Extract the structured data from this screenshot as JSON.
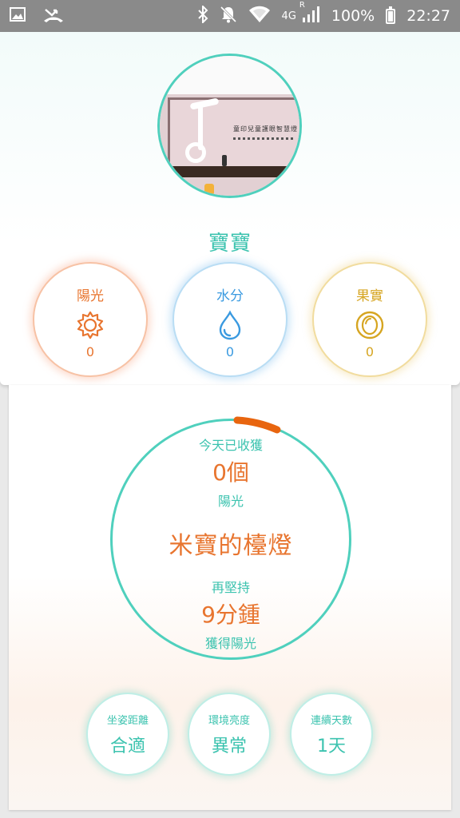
{
  "status_bar": {
    "network": "4G",
    "signal_badge": "R",
    "battery": "100%",
    "time": "22:27",
    "icons": [
      "gallery-icon",
      "missed-call-icon",
      "bluetooth-icon",
      "bell-off-icon",
      "wifi-icon",
      "signal-icon",
      "battery-icon"
    ]
  },
  "profile": {
    "name": "寶寶",
    "photo_caption": "童印兒童護眼智慧燈"
  },
  "stats": [
    {
      "label": "陽光",
      "value": "0",
      "icon": "sun-icon",
      "color": "#e8752f"
    },
    {
      "label": "水分",
      "value": "0",
      "icon": "water-drop-icon",
      "color": "#3a9ae0"
    },
    {
      "label": "果實",
      "value": "0",
      "icon": "fruit-icon",
      "color": "#d6a521"
    }
  ],
  "harvest": {
    "today_label": "今天已收獲",
    "today_value": "0個",
    "today_unit": "陽光",
    "lamp_name": "米寶的檯燈",
    "persist_label": "再堅持",
    "remaining": "9分鍾",
    "reward_label": "獲得陽光"
  },
  "metrics": [
    {
      "label": "坐姿距離",
      "value": "合適"
    },
    {
      "label": "環境亮度",
      "value": "異常"
    },
    {
      "label": "連續天數",
      "value": "1天"
    }
  ],
  "colors": {
    "accent_teal": "#4fd0bd",
    "accent_orange": "#e8752f"
  }
}
